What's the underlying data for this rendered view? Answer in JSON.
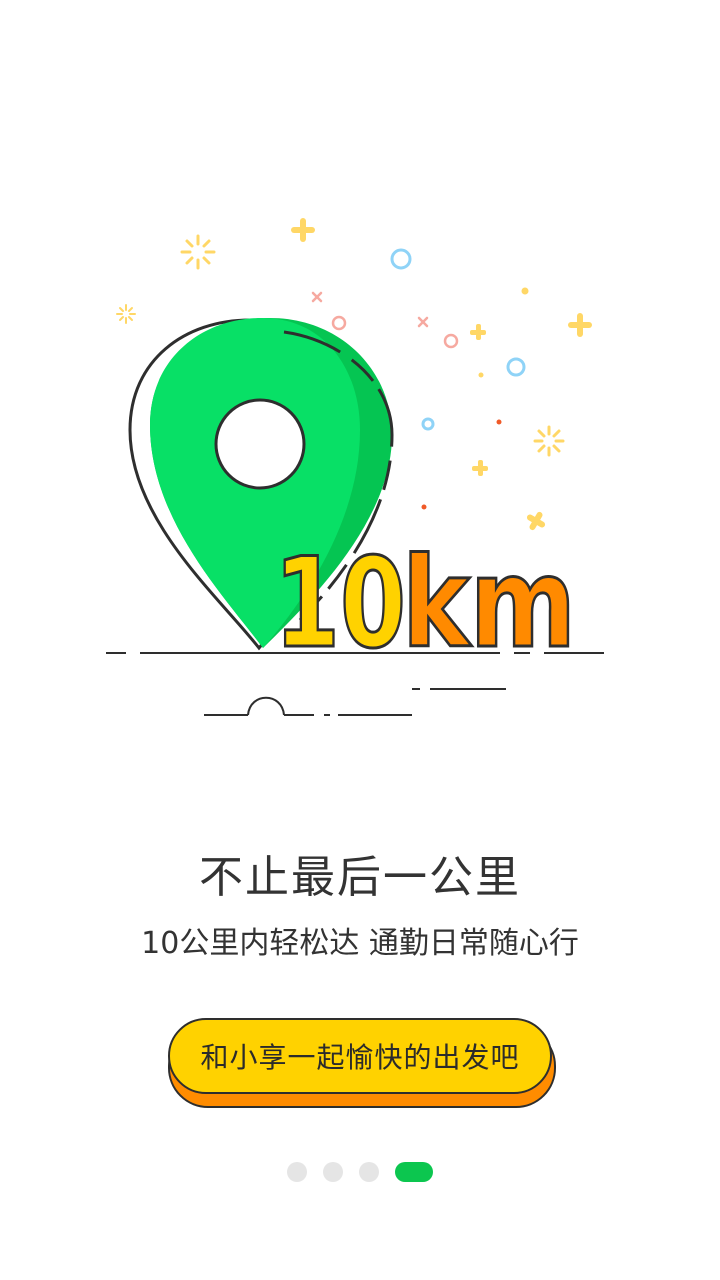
{
  "illustration": {
    "badge_number": "10",
    "badge_unit": "km"
  },
  "content": {
    "title": "不止最后一公里",
    "subtitle": "10公里内轻松达 通勤日常随心行",
    "cta_label": "和小享一起愉快的出发吧"
  },
  "pager": {
    "total_pages": 4,
    "current_page": 4
  },
  "colors": {
    "pin_green": "#08e066",
    "pin_green_dark": "#05c552",
    "badge_yellow": "#ffd200",
    "badge_orange": "#ff8a00",
    "button_yellow": "#ffd200",
    "button_shadow": "#ff8c00",
    "active_dot": "#0cc64f",
    "inactive_dot": "#e5e5e5"
  }
}
